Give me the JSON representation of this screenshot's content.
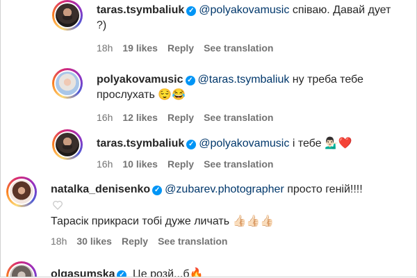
{
  "comments": [
    {
      "username": "taras.tsymbaliuk",
      "mention": "@polyakovamusic",
      "text": "співаю. Давай дует ?)",
      "time": "18h",
      "likes": "19 likes",
      "reply": "Reply",
      "translate": "See translation"
    },
    {
      "username": "polyakovamusic",
      "mention": "@taras.tsymbaliuk",
      "text": "ну треба тебе прослухать 😌😂",
      "time": "16h",
      "likes": "12 likes",
      "reply": "Reply",
      "translate": "See translation"
    },
    {
      "username": "taras.tsymbaliuk",
      "mention": "@polyakovamusic",
      "text": "і тебе 💁🏻‍♂️❤️",
      "time": "16h",
      "likes": "10 likes",
      "reply": "Reply",
      "translate": "See translation"
    },
    {
      "username": "natalka_denisenko",
      "mention": "@zubarev.photographer",
      "text": "просто геній!!!!",
      "text2": "Тарасік прикраси тобі дуже личать 👍🏻👍🏻👍🏻",
      "time": "18h",
      "likes": "30 likes",
      "reply": "Reply",
      "translate": "See translation"
    },
    {
      "username": "olgasumska",
      "text": "Це розй...б🔥"
    }
  ],
  "icons": {
    "verified": "verified-badge-icon",
    "heart": "heart-outline-icon"
  },
  "colors": {
    "verified": "#0095f6",
    "mention": "#00376b",
    "meta": "#737373"
  }
}
